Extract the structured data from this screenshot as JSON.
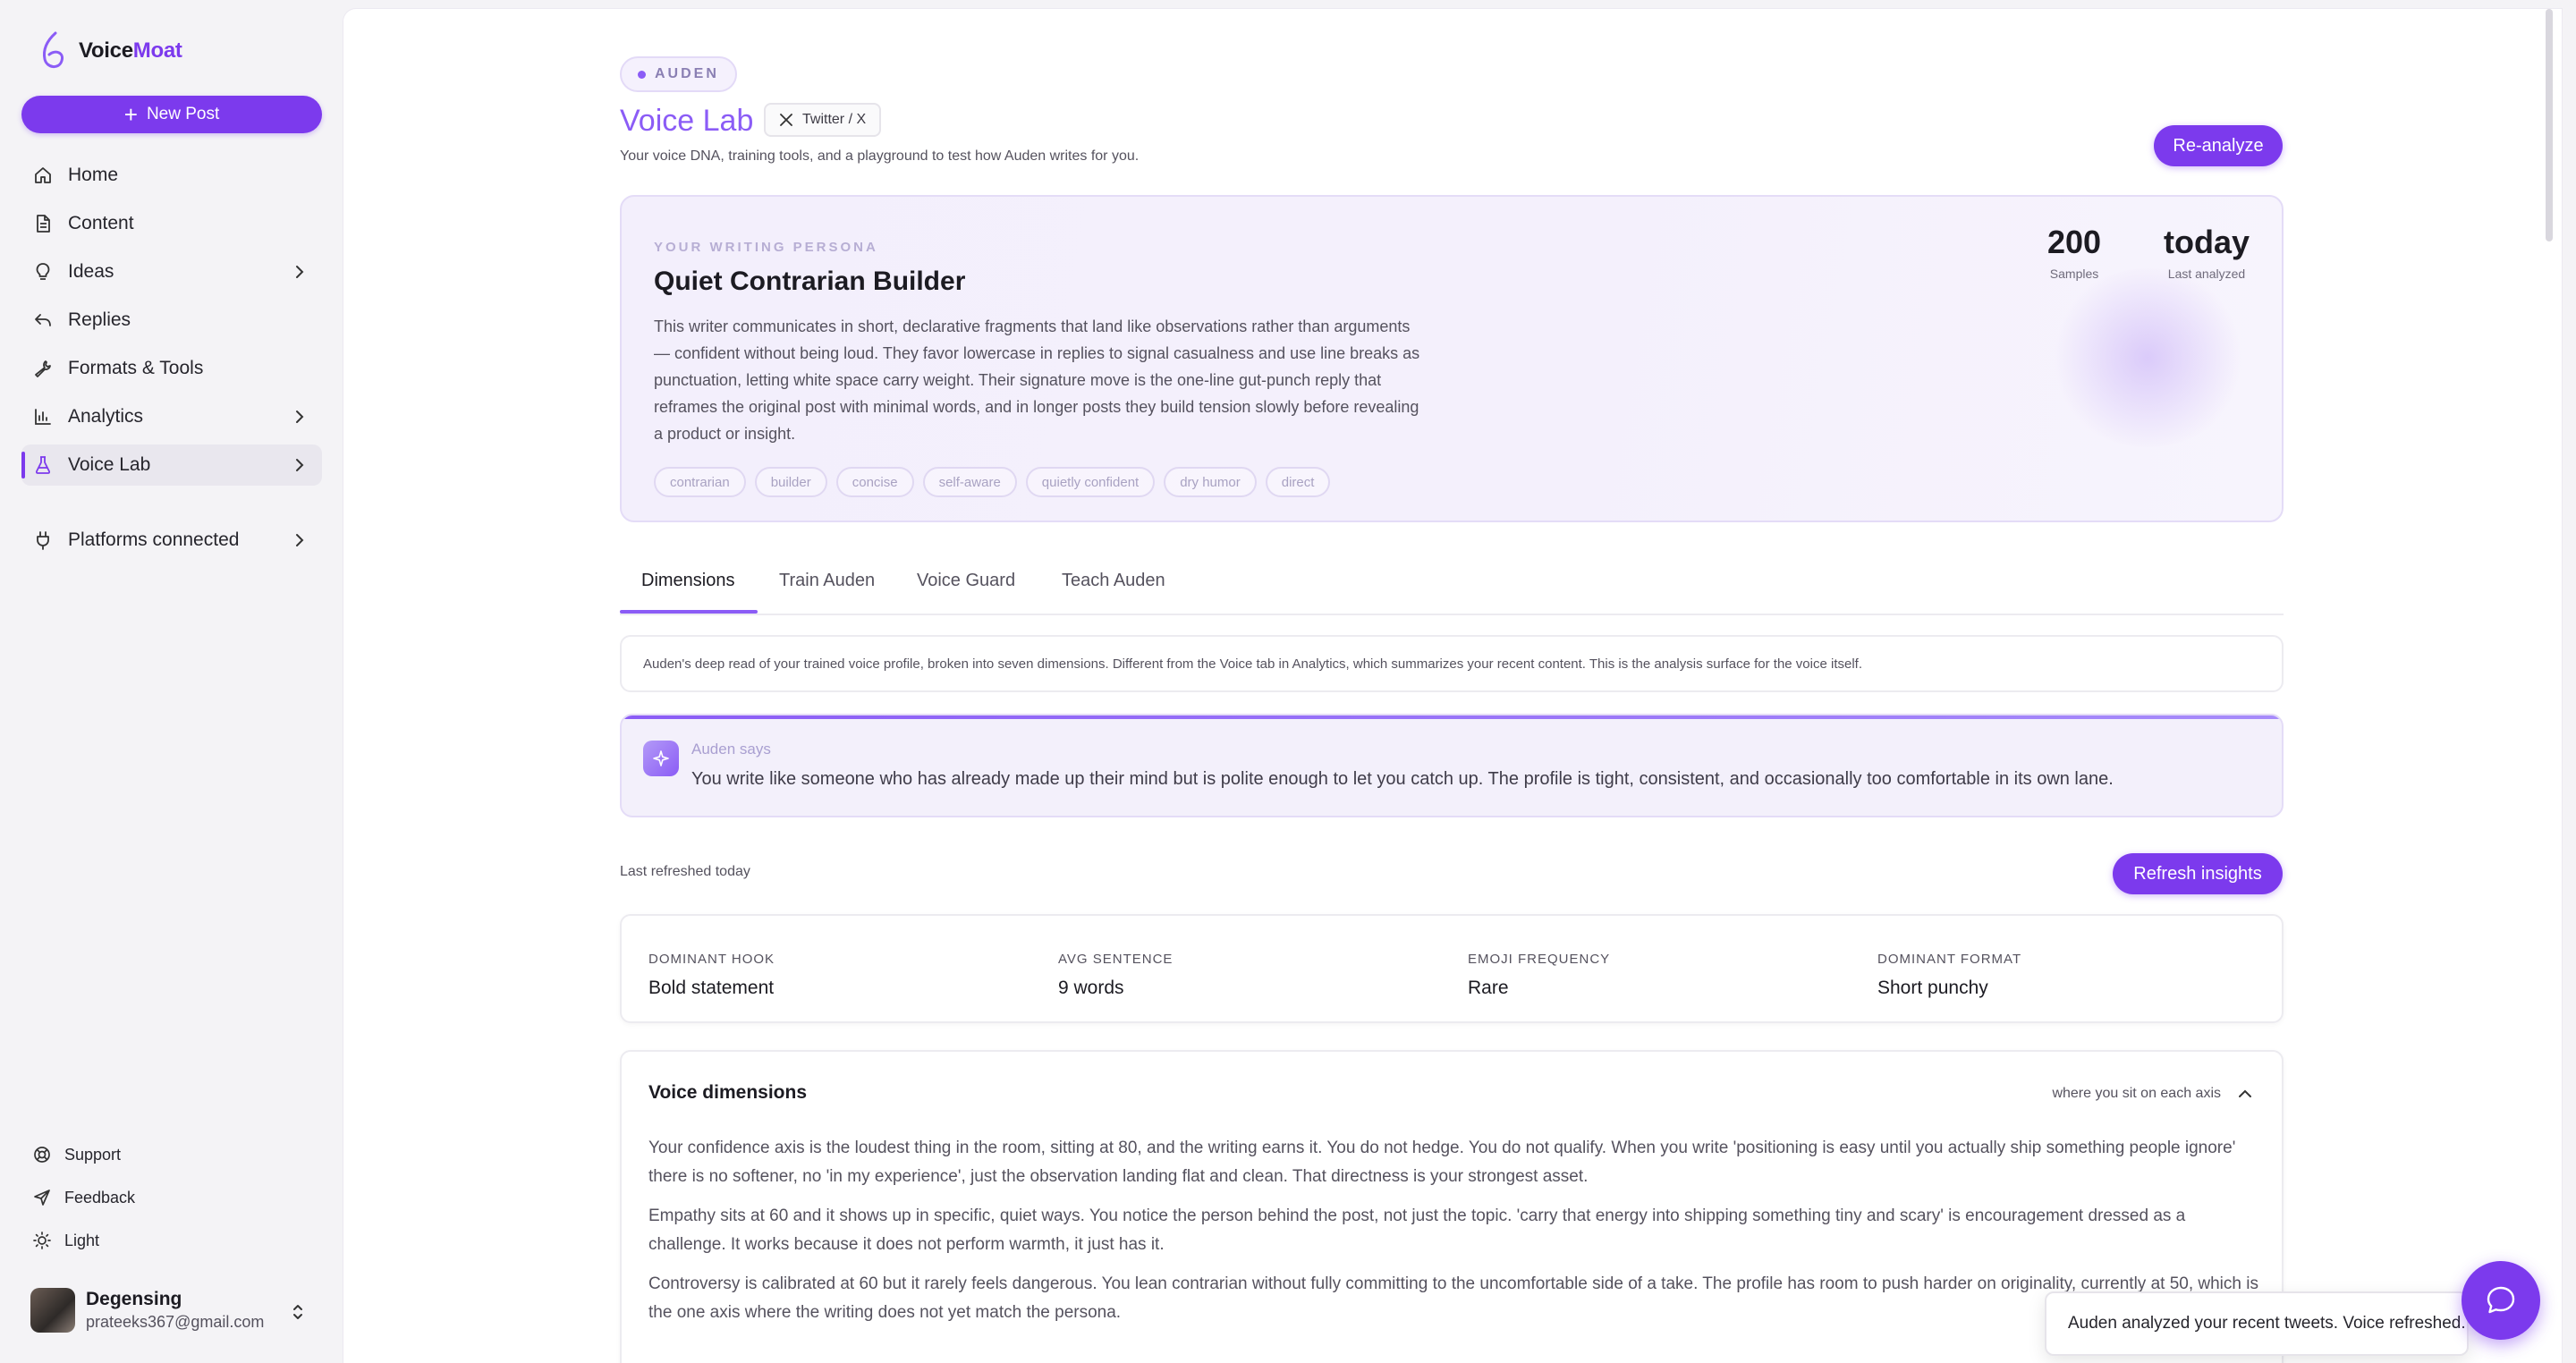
{
  "app": {
    "name_part1": "Voice",
    "name_part2": "Moat"
  },
  "sidebar": {
    "new_post_label": "New Post",
    "items": [
      {
        "label": "Home",
        "icon": "home-icon"
      },
      {
        "label": "Content",
        "icon": "document-icon"
      },
      {
        "label": "Ideas",
        "icon": "lightbulb-icon"
      },
      {
        "label": "Replies",
        "icon": "reply-icon"
      },
      {
        "label": "Formats & Tools",
        "icon": "wrench-icon"
      },
      {
        "label": "Analytics",
        "icon": "bar-chart-icon"
      },
      {
        "label": "Voice Lab",
        "icon": "flask-icon"
      },
      {
        "label": "Platforms connected",
        "icon": "plug-icon"
      }
    ],
    "footer": [
      {
        "label": "Support",
        "icon": "lifebuoy-icon"
      },
      {
        "label": "Feedback",
        "icon": "send-icon"
      },
      {
        "label": "Light",
        "icon": "sun-icon"
      }
    ],
    "user": {
      "name": "Degensing",
      "email": "prateeks367@gmail.com"
    }
  },
  "header": {
    "persona_pill": "AUDEN",
    "title": "Voice Lab",
    "platform_chip": "Twitter / X",
    "subtitle": "Your voice DNA, training tools, and a playground to test how Auden writes for you.",
    "reanalyze_label": "Re-analyze"
  },
  "persona": {
    "eyebrow": "YOUR WRITING PERSONA",
    "name": "Quiet Contrarian Builder",
    "description": "This writer communicates in short, declarative fragments that land like observations rather than arguments — confident without being loud. They favor lowercase in replies to signal casualness and use line breaks as punctuation, letting white space carry weight. Their signature move is the one-line gut-punch reply that reframes the original post with minimal words, and in longer posts they build tension slowly before revealing a product or insight.",
    "tags": [
      "contrarian",
      "builder",
      "concise",
      "self-aware",
      "quietly confident",
      "dry humor",
      "direct"
    ],
    "stats": [
      {
        "value": "200",
        "label": "Samples"
      },
      {
        "value": "today",
        "label": "Last analyzed"
      }
    ]
  },
  "tabs": [
    "Dimensions",
    "Train Auden",
    "Voice Guard",
    "Teach Auden"
  ],
  "info_text": "Auden's deep read of your trained voice profile, broken into seven dimensions. Different from the Voice tab in Analytics, which summarizes your recent content. This is the analysis surface for the voice itself.",
  "auden": {
    "label": "Auden says",
    "quote": "You write like someone who has already made up their mind but is polite enough to let you catch up. The profile is tight, consistent, and occasionally too comfortable in its own lane."
  },
  "insights": {
    "last_refreshed": "Last refreshed today",
    "refresh_label": "Refresh insights"
  },
  "metrics": [
    {
      "key": "DOMINANT HOOK",
      "value": "Bold statement"
    },
    {
      "key": "AVG SENTENCE",
      "value": "9 words"
    },
    {
      "key": "EMOJI FREQUENCY",
      "value": "Rare"
    },
    {
      "key": "DOMINANT FORMAT",
      "value": "Short punchy"
    }
  ],
  "dimensions": {
    "title": "Voice dimensions",
    "hint": "where you sit on each axis",
    "paragraphs": [
      "Your confidence axis is the loudest thing in the room, sitting at 80, and the writing earns it. You do not hedge. You do not qualify. When you write 'positioning is easy until you actually ship something people ignore' there is no softener, no 'in my experience', just the observation landing flat and clean. That directness is your strongest asset.",
      "Empathy sits at 60 and it shows up in specific, quiet ways. You notice the person behind the post, not just the topic. 'carry that energy into shipping something tiny and scary' is encouragement dressed as a challenge. It works because it does not perform warmth, it just has it.",
      "Controversy is calibrated at 60 but it rarely feels dangerous. You lean contrarian without fully committing to the uncomfortable side of a take. The profile has room to push harder on originality, currently at 50, which is the one axis where the writing does not yet match the persona."
    ]
  },
  "toast": "Auden analyzed your recent tweets. Voice refreshed."
}
